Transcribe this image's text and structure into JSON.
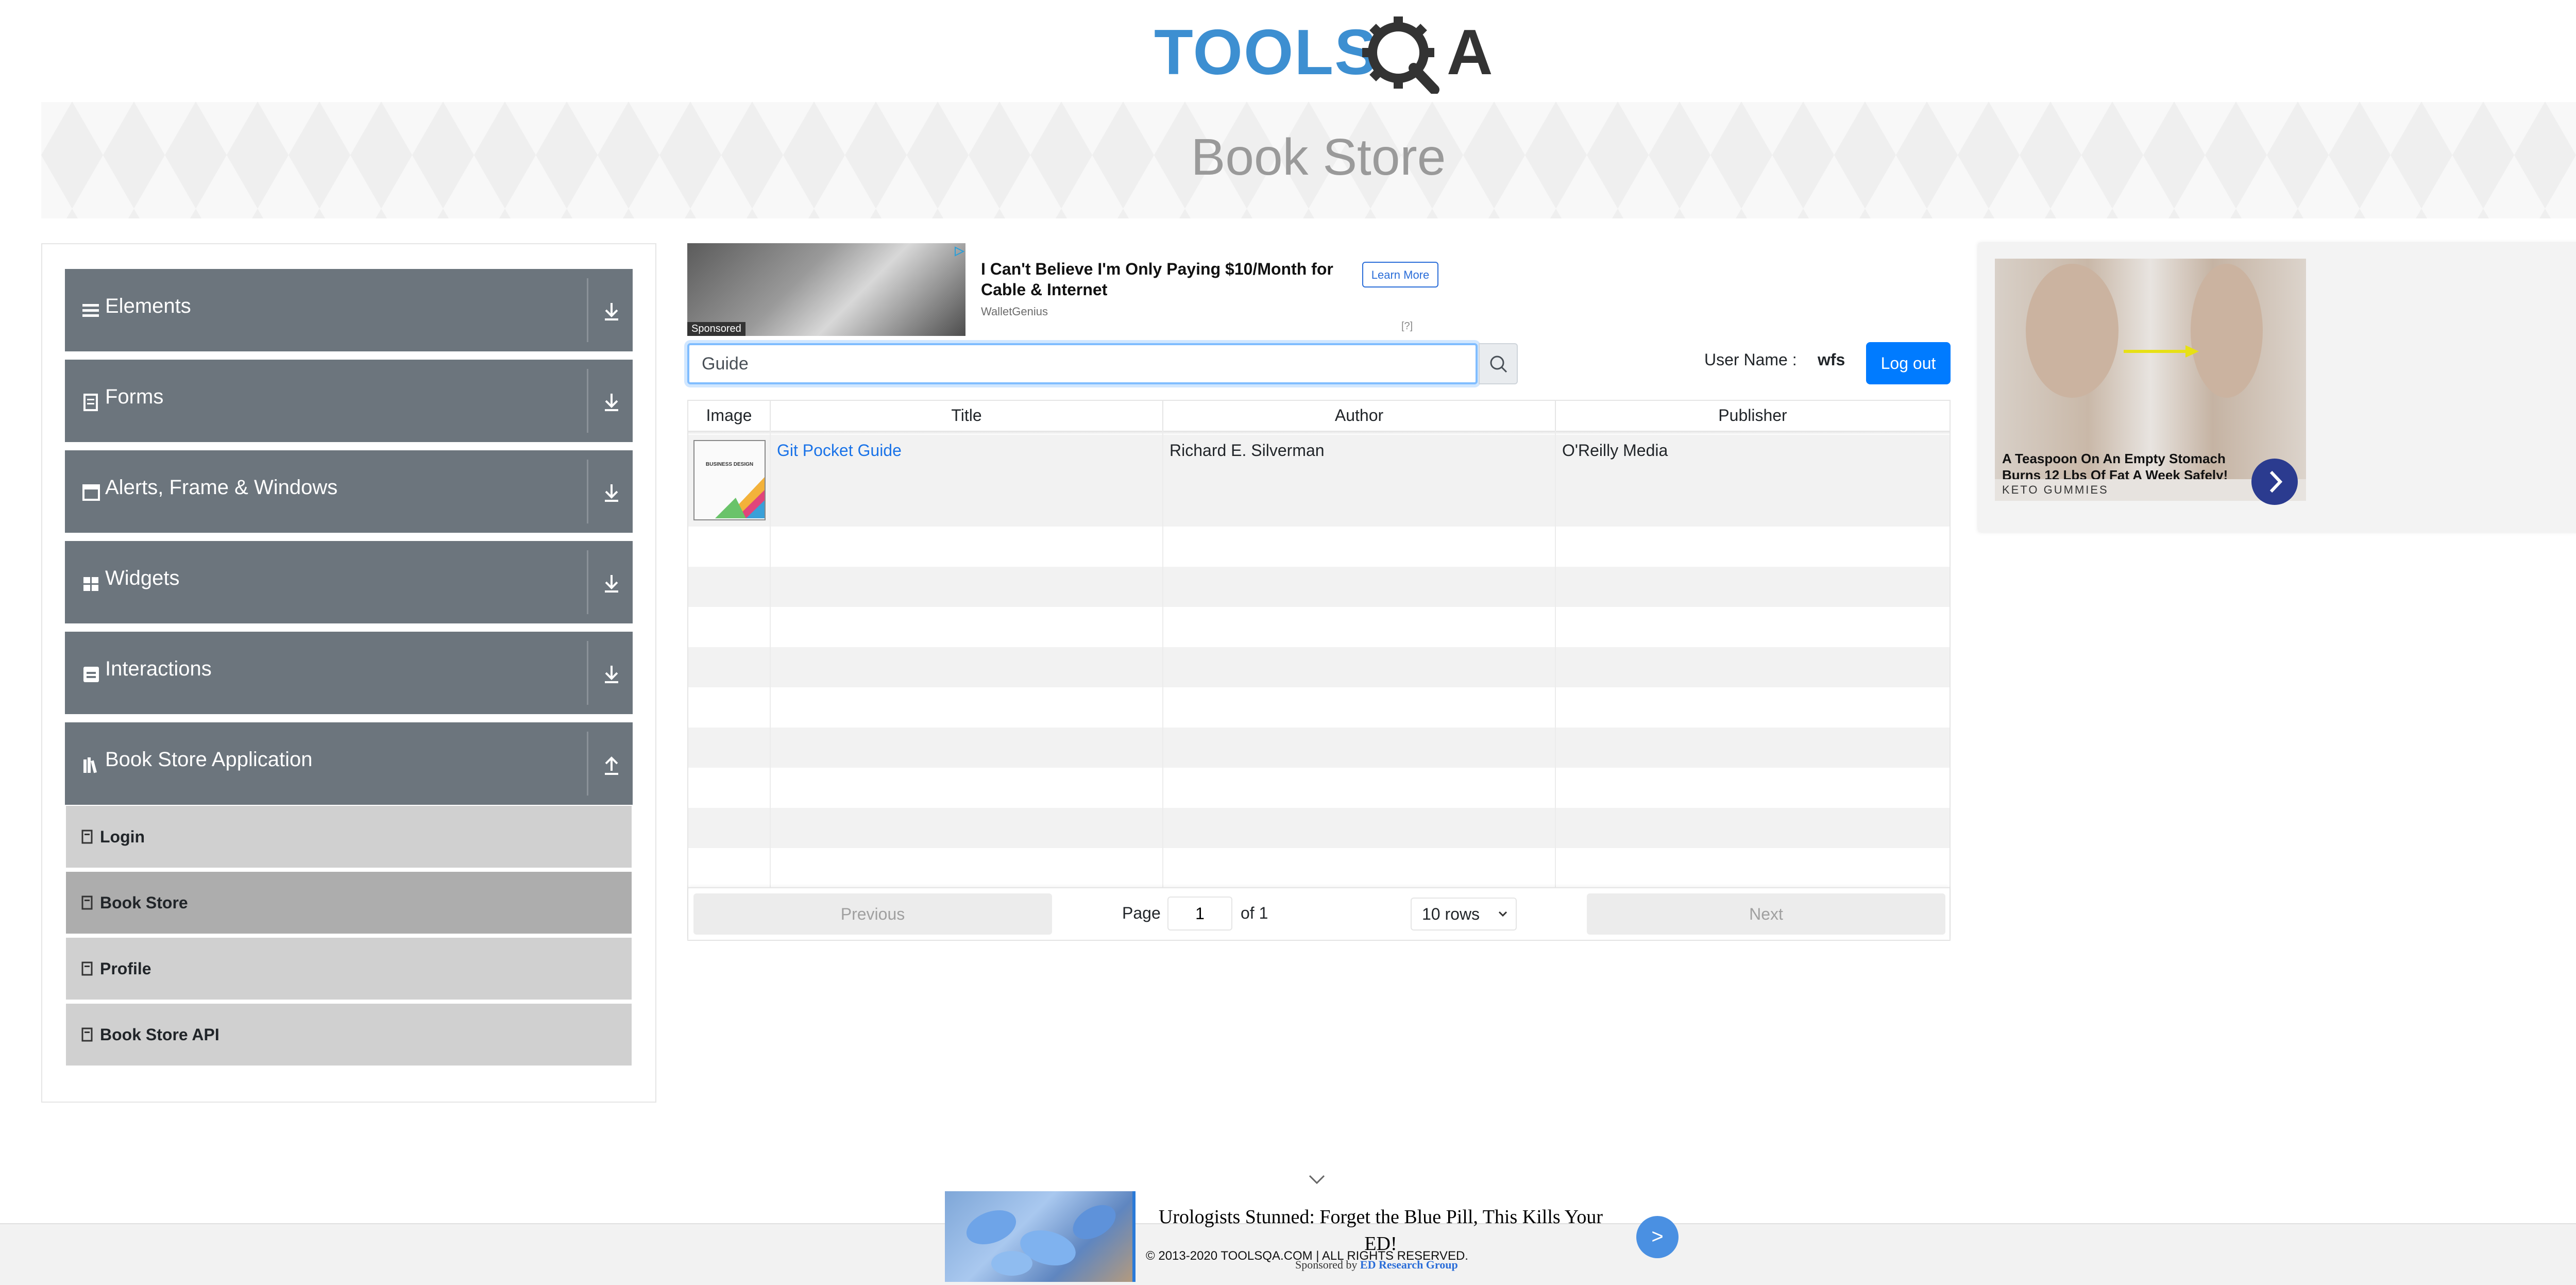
{
  "header": {
    "logo_text": "TOOLSQA",
    "banner_title": "Book Store"
  },
  "sidebar": {
    "groups": [
      {
        "label": "Elements",
        "icon": "list-icon"
      },
      {
        "label": "Forms",
        "icon": "form-icon"
      },
      {
        "label": "Alerts, Frame & Windows",
        "icon": "window-icon"
      },
      {
        "label": "Widgets",
        "icon": "widgets-icon"
      },
      {
        "label": "Interactions",
        "icon": "interactions-icon"
      },
      {
        "label": "Book Store Application",
        "icon": "books-icon"
      }
    ],
    "sub_items": [
      {
        "label": "Login",
        "active": false
      },
      {
        "label": "Book Store",
        "active": true
      },
      {
        "label": "Profile",
        "active": false
      },
      {
        "label": "Book Store API",
        "active": false
      }
    ]
  },
  "ad_top": {
    "headline": "I Can't Believe I'm Only Paying $10/Month for Cable & Internet",
    "source": "WalletGenius",
    "cta": "Learn More",
    "badge": "Sponsored",
    "info": "[?]"
  },
  "search": {
    "value": "Guide"
  },
  "user": {
    "label": "User Name :",
    "value": "wfs",
    "logout_label": "Log out"
  },
  "table": {
    "headers": [
      "Image",
      "Title",
      "Author",
      "Publisher"
    ],
    "rows": [
      {
        "title": "Git Pocket Guide",
        "author": "Richard E. Silverman",
        "publisher": "O'Reilly Media",
        "cover_text": "BUSINESS DESIGN"
      }
    ]
  },
  "pager": {
    "previous": "Previous",
    "next": "Next",
    "page_label": "Page",
    "page_value": "1",
    "of_label": "of 1",
    "rows_label": "10 rows"
  },
  "ad_right": {
    "headline": "A Teaspoon On An Empty Stomach Burns 12 Lbs Of Fat A Week Safely!",
    "brand": "KETO GUMMIES"
  },
  "ad_bottom": {
    "headline": "Urologists Stunned: Forget the Blue Pill, This Kills Your ED!",
    "sponsored_prefix": "Sponsored by",
    "sponsor": "ED Research Group",
    "cta": ">"
  },
  "footer": {
    "copyright": "© 2013-2020 TOOLSQA.COM | ALL RIGHTS RESERVED."
  },
  "colors": {
    "primary": "#007bff",
    "sidebar_group": "#6c757d",
    "sidebar_sub": "#d0d0d0",
    "link": "#1a73e8"
  }
}
